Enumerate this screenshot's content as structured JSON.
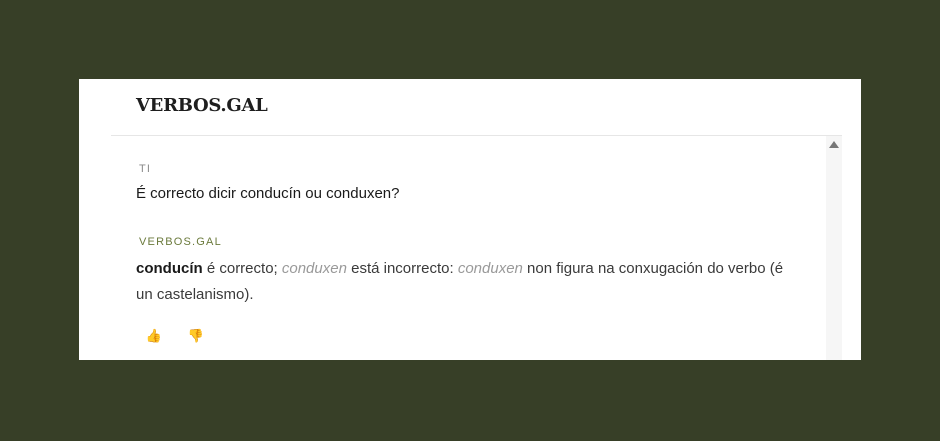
{
  "header": {
    "brand": "VERBOS.GAL"
  },
  "conversation": {
    "user_label": "TI",
    "question": "É correcto dicir conducín ou conduxen?",
    "bot_label": "VERBOS.GAL",
    "answer": {
      "part1_bold": "conducín",
      "part2": " é correcto; ",
      "part3_italic": "conduxen",
      "part4": " está incorrecto: ",
      "part5_italic": "conduxen",
      "part6": " non figura na conxugación do verbo (é un castelanismo)."
    }
  },
  "feedback": {
    "up_icon": "👍",
    "down_icon": "👎"
  }
}
